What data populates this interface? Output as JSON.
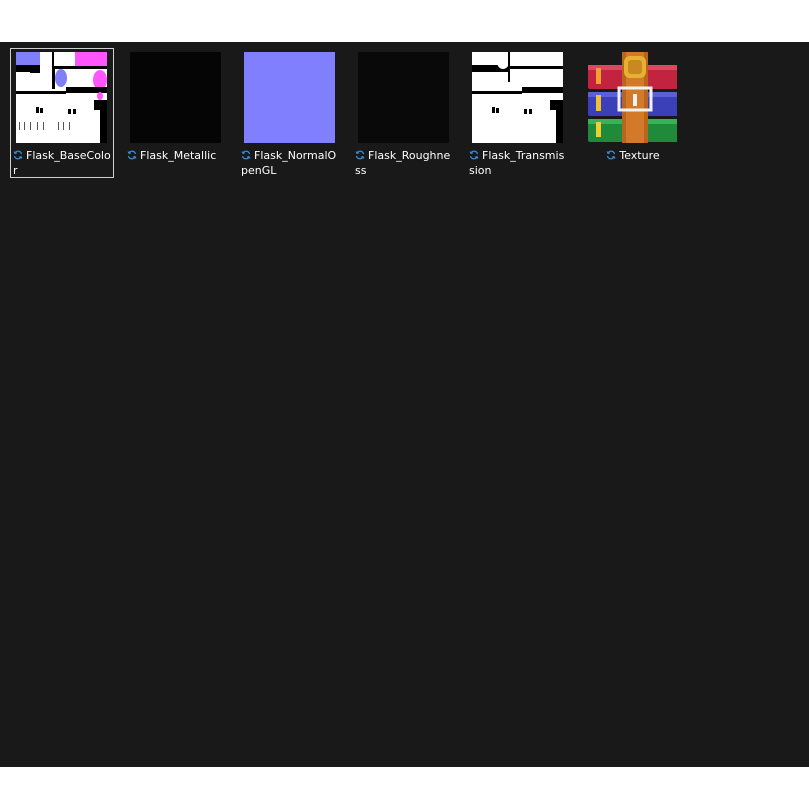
{
  "files": [
    {
      "name": "Flask_BaseColor",
      "icon": "sync-icon"
    },
    {
      "name": "Flask_Metallic",
      "icon": "sync-icon"
    },
    {
      "name": "Flask_NormalOpenGL",
      "icon": "sync-icon"
    },
    {
      "name": "Flask_Roughness",
      "icon": "sync-icon"
    },
    {
      "name": "Flask_Transmission",
      "icon": "sync-icon"
    },
    {
      "name": "Texture",
      "icon": "sync-icon",
      "type": "winrar-archive-icon"
    }
  ],
  "selected_file": "Flask_BaseColor",
  "colors": {
    "window_background": "#191919",
    "normal_map": "#8080ff",
    "sync_icon": "#3a8fd8"
  }
}
